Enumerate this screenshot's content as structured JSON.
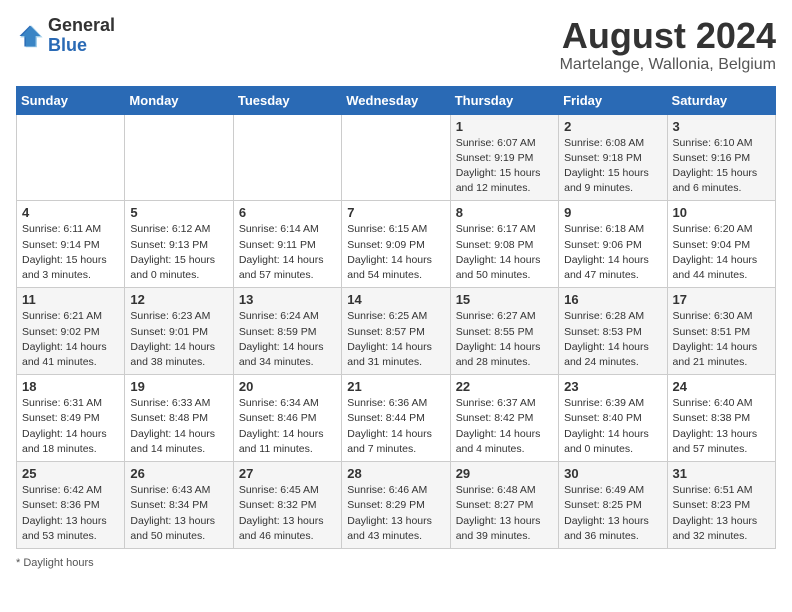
{
  "header": {
    "logo_general": "General",
    "logo_blue": "Blue",
    "month_year": "August 2024",
    "location": "Martelange, Wallonia, Belgium"
  },
  "days_of_week": [
    "Sunday",
    "Monday",
    "Tuesday",
    "Wednesday",
    "Thursday",
    "Friday",
    "Saturday"
  ],
  "weeks": [
    [
      {
        "day": "",
        "info": ""
      },
      {
        "day": "",
        "info": ""
      },
      {
        "day": "",
        "info": ""
      },
      {
        "day": "",
        "info": ""
      },
      {
        "day": "1",
        "info": "Sunrise: 6:07 AM\nSunset: 9:19 PM\nDaylight: 15 hours\nand 12 minutes."
      },
      {
        "day": "2",
        "info": "Sunrise: 6:08 AM\nSunset: 9:18 PM\nDaylight: 15 hours\nand 9 minutes."
      },
      {
        "day": "3",
        "info": "Sunrise: 6:10 AM\nSunset: 9:16 PM\nDaylight: 15 hours\nand 6 minutes."
      }
    ],
    [
      {
        "day": "4",
        "info": "Sunrise: 6:11 AM\nSunset: 9:14 PM\nDaylight: 15 hours\nand 3 minutes."
      },
      {
        "day": "5",
        "info": "Sunrise: 6:12 AM\nSunset: 9:13 PM\nDaylight: 15 hours\nand 0 minutes."
      },
      {
        "day": "6",
        "info": "Sunrise: 6:14 AM\nSunset: 9:11 PM\nDaylight: 14 hours\nand 57 minutes."
      },
      {
        "day": "7",
        "info": "Sunrise: 6:15 AM\nSunset: 9:09 PM\nDaylight: 14 hours\nand 54 minutes."
      },
      {
        "day": "8",
        "info": "Sunrise: 6:17 AM\nSunset: 9:08 PM\nDaylight: 14 hours\nand 50 minutes."
      },
      {
        "day": "9",
        "info": "Sunrise: 6:18 AM\nSunset: 9:06 PM\nDaylight: 14 hours\nand 47 minutes."
      },
      {
        "day": "10",
        "info": "Sunrise: 6:20 AM\nSunset: 9:04 PM\nDaylight: 14 hours\nand 44 minutes."
      }
    ],
    [
      {
        "day": "11",
        "info": "Sunrise: 6:21 AM\nSunset: 9:02 PM\nDaylight: 14 hours\nand 41 minutes."
      },
      {
        "day": "12",
        "info": "Sunrise: 6:23 AM\nSunset: 9:01 PM\nDaylight: 14 hours\nand 38 minutes."
      },
      {
        "day": "13",
        "info": "Sunrise: 6:24 AM\nSunset: 8:59 PM\nDaylight: 14 hours\nand 34 minutes."
      },
      {
        "day": "14",
        "info": "Sunrise: 6:25 AM\nSunset: 8:57 PM\nDaylight: 14 hours\nand 31 minutes."
      },
      {
        "day": "15",
        "info": "Sunrise: 6:27 AM\nSunset: 8:55 PM\nDaylight: 14 hours\nand 28 minutes."
      },
      {
        "day": "16",
        "info": "Sunrise: 6:28 AM\nSunset: 8:53 PM\nDaylight: 14 hours\nand 24 minutes."
      },
      {
        "day": "17",
        "info": "Sunrise: 6:30 AM\nSunset: 8:51 PM\nDaylight: 14 hours\nand 21 minutes."
      }
    ],
    [
      {
        "day": "18",
        "info": "Sunrise: 6:31 AM\nSunset: 8:49 PM\nDaylight: 14 hours\nand 18 minutes."
      },
      {
        "day": "19",
        "info": "Sunrise: 6:33 AM\nSunset: 8:48 PM\nDaylight: 14 hours\nand 14 minutes."
      },
      {
        "day": "20",
        "info": "Sunrise: 6:34 AM\nSunset: 8:46 PM\nDaylight: 14 hours\nand 11 minutes."
      },
      {
        "day": "21",
        "info": "Sunrise: 6:36 AM\nSunset: 8:44 PM\nDaylight: 14 hours\nand 7 minutes."
      },
      {
        "day": "22",
        "info": "Sunrise: 6:37 AM\nSunset: 8:42 PM\nDaylight: 14 hours\nand 4 minutes."
      },
      {
        "day": "23",
        "info": "Sunrise: 6:39 AM\nSunset: 8:40 PM\nDaylight: 14 hours\nand 0 minutes."
      },
      {
        "day": "24",
        "info": "Sunrise: 6:40 AM\nSunset: 8:38 PM\nDaylight: 13 hours\nand 57 minutes."
      }
    ],
    [
      {
        "day": "25",
        "info": "Sunrise: 6:42 AM\nSunset: 8:36 PM\nDaylight: 13 hours\nand 53 minutes."
      },
      {
        "day": "26",
        "info": "Sunrise: 6:43 AM\nSunset: 8:34 PM\nDaylight: 13 hours\nand 50 minutes."
      },
      {
        "day": "27",
        "info": "Sunrise: 6:45 AM\nSunset: 8:32 PM\nDaylight: 13 hours\nand 46 minutes."
      },
      {
        "day": "28",
        "info": "Sunrise: 6:46 AM\nSunset: 8:29 PM\nDaylight: 13 hours\nand 43 minutes."
      },
      {
        "day": "29",
        "info": "Sunrise: 6:48 AM\nSunset: 8:27 PM\nDaylight: 13 hours\nand 39 minutes."
      },
      {
        "day": "30",
        "info": "Sunrise: 6:49 AM\nSunset: 8:25 PM\nDaylight: 13 hours\nand 36 minutes."
      },
      {
        "day": "31",
        "info": "Sunrise: 6:51 AM\nSunset: 8:23 PM\nDaylight: 13 hours\nand 32 minutes."
      }
    ]
  ],
  "footer": {
    "note": "Daylight hours"
  }
}
